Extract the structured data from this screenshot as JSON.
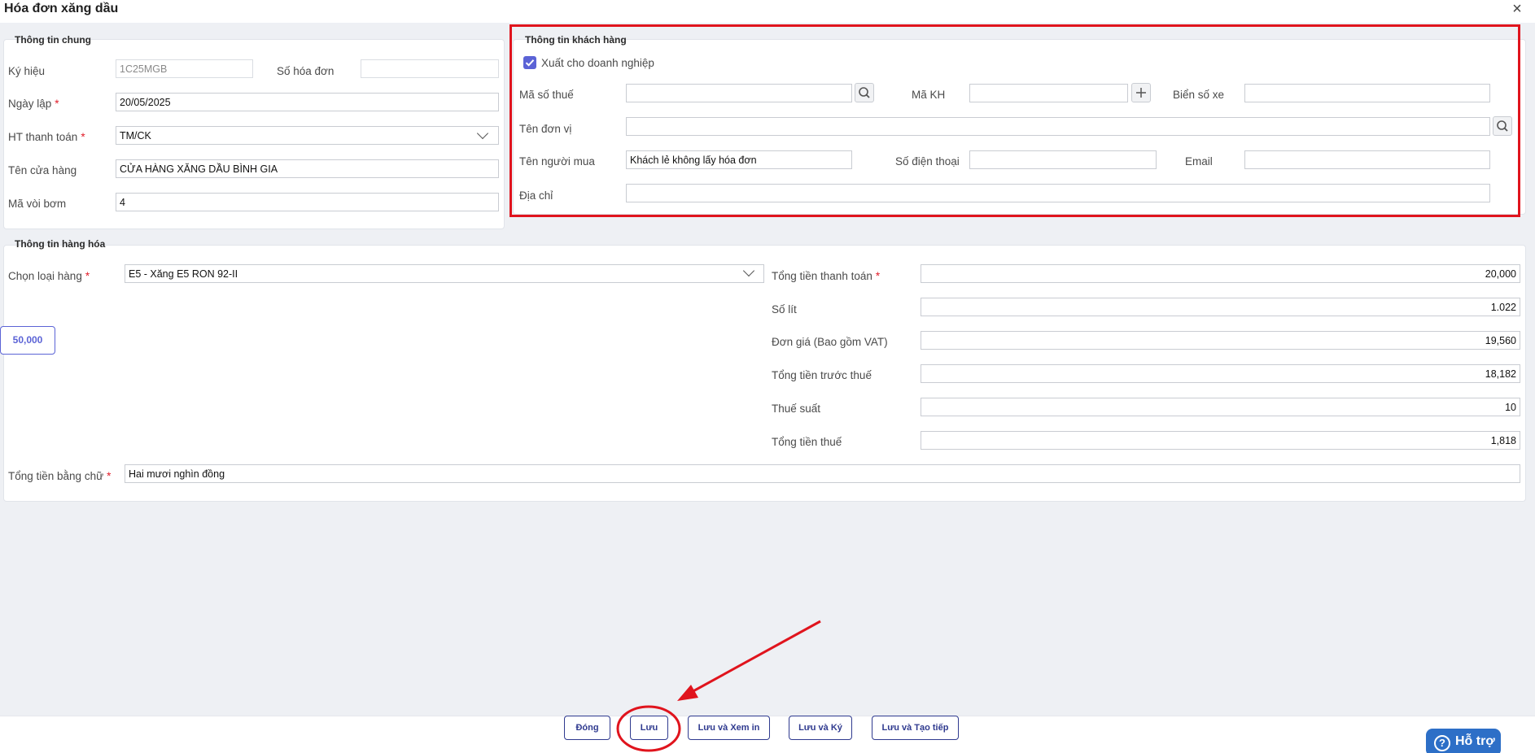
{
  "window": {
    "title": "Hóa đơn xăng dầu",
    "close_symbol": "×"
  },
  "general": {
    "title": "Thông tin chung",
    "ky_hieu_label": "Ký hiệu",
    "ky_hieu_value": "1C25MGB",
    "so_hoa_don_label": "Số hóa đơn",
    "so_hoa_don_value": "",
    "ngay_lap_label": "Ngày lập",
    "ngay_lap_value": "20/05/2025",
    "ht_thanh_toan_label": "HT thanh toán",
    "ht_thanh_toan_value": "TM/CK",
    "ten_cua_hang_label": "Tên cửa hàng",
    "ten_cua_hang_value": "CỬA HÀNG XĂNG DẦU BÌNH GIA",
    "ma_voi_bom_label": "Mã vòi bơm",
    "ma_voi_bom_value": "4",
    "required_mark": "*"
  },
  "customer": {
    "title": "Thông tin khách hàng",
    "xuat_dn_label": "Xuất cho doanh nghiệp",
    "xuat_dn_checked": true,
    "ma_so_thue_label": "Mã số thuế",
    "ma_so_thue_value": "",
    "ma_kh_label": "Mã KH",
    "ma_kh_value": "",
    "bien_so_xe_label": "Biển số xe",
    "bien_so_xe_value": "",
    "ten_don_vi_label": "Tên đơn vị",
    "ten_don_vi_value": "",
    "ten_nguoi_mua_label": "Tên người mua",
    "ten_nguoi_mua_value": "Khách lẻ không lấy hóa đơn",
    "so_dien_thoai_label": "Số điện thoại",
    "so_dien_thoai_value": "",
    "email_label": "Email",
    "email_value": "",
    "dia_chi_label": "Địa chỉ",
    "dia_chi_value": ""
  },
  "goods": {
    "title": "Thông tin hàng hóa",
    "chon_loai_hang_label": "Chọn loại hàng",
    "chon_loai_hang_value": "E5 - Xăng E5 RON 92-II",
    "quick_amount": "50,000",
    "tong_tien_thanh_toan_label": "Tổng tiền thanh toán",
    "tong_tien_thanh_toan_value": "20,000",
    "so_lit_label": "Số lít",
    "so_lit_value": "1.022",
    "don_gia_label": "Đơn giá (Bao gồm VAT)",
    "don_gia_value": "19,560",
    "tong_tien_truoc_thue_label": "Tổng tiền trước thuế",
    "tong_tien_truoc_thue_value": "18,182",
    "thue_suat_label": "Thuế suất",
    "thue_suat_value": "10",
    "tong_tien_thue_label": "Tổng tiền thuế",
    "tong_tien_thue_value": "1,818",
    "tong_tien_bang_chu_label": "Tổng tiền bằng chữ",
    "tong_tien_bang_chu_value": "Hai mươi nghìn đồng"
  },
  "footer": {
    "dong": "Đóng",
    "luu": "Lưu",
    "luu_xem_in": "Lưu và Xem in",
    "luu_ky": "Lưu và Ký",
    "luu_tao_tiep": "Lưu và Tạo tiếp"
  },
  "help": {
    "label": "Hỗ trợ",
    "icon": "?"
  },
  "colors": {
    "accent": "#5b63d6",
    "annotation": "#e0141d",
    "help": "#2d6fc7"
  }
}
